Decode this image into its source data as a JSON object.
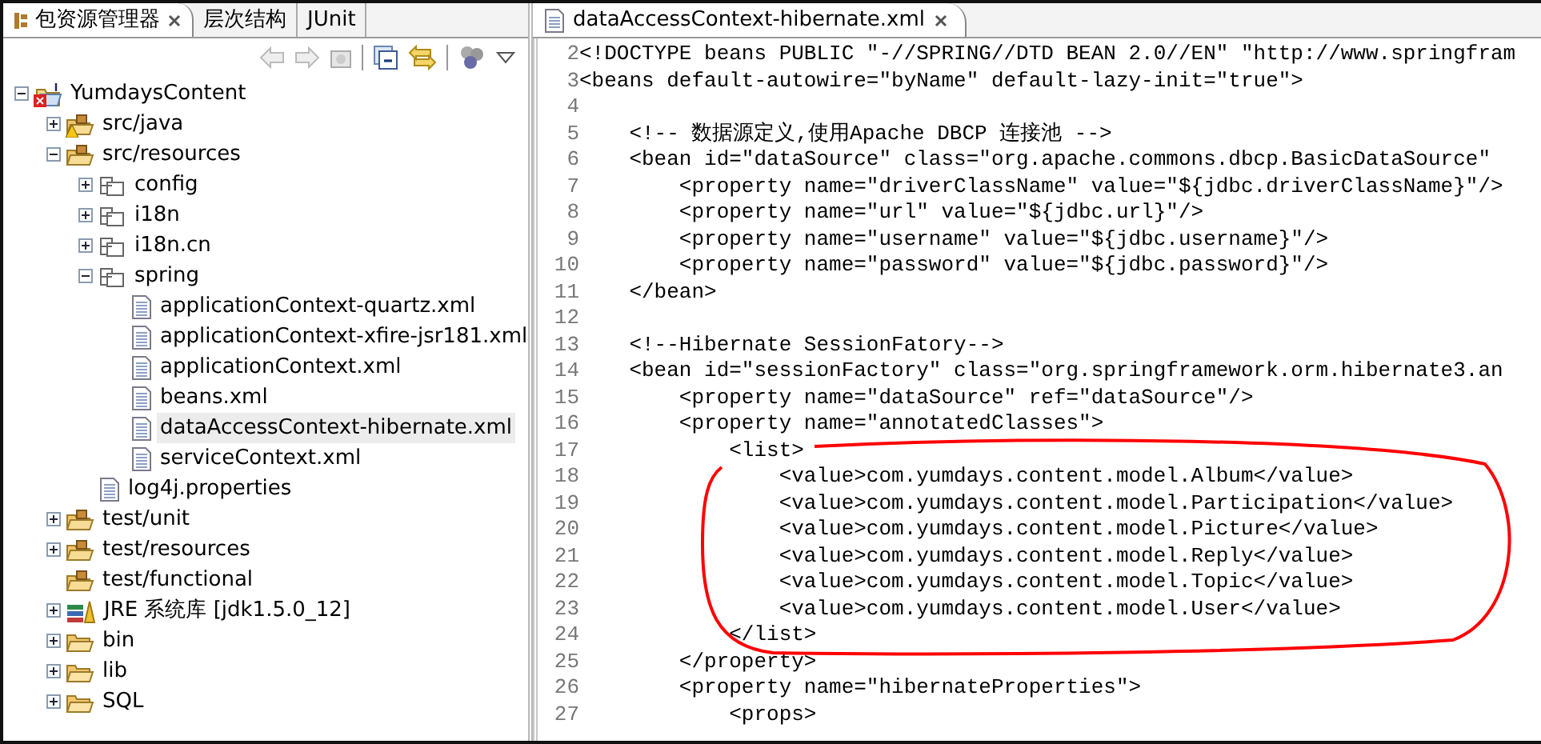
{
  "explorer": {
    "tabs": [
      {
        "label": "包资源管理器",
        "selected": true,
        "closable": true
      },
      {
        "label": "层次结构",
        "selected": false,
        "closable": false
      },
      {
        "label": "JUnit",
        "selected": false,
        "closable": false
      }
    ],
    "tree": [
      {
        "label": "YumdaysContent",
        "kind": "project",
        "error": true,
        "expanded": true,
        "selected": false,
        "children": [
          {
            "label": "src/java",
            "kind": "srcfolder",
            "warning": true,
            "expanded": false,
            "selected": false
          },
          {
            "label": "src/resources",
            "kind": "srcfolder",
            "expanded": true,
            "selected": false,
            "children": [
              {
                "label": "config",
                "kind": "package",
                "expanded": false,
                "selected": false
              },
              {
                "label": "i18n",
                "kind": "package",
                "expanded": false,
                "selected": false
              },
              {
                "label": "i18n.cn",
                "kind": "package",
                "expanded": false,
                "selected": false
              },
              {
                "label": "spring",
                "kind": "package",
                "expanded": true,
                "selected": false,
                "children": [
                  {
                    "label": "applicationContext-quartz.xml",
                    "kind": "file",
                    "selected": false
                  },
                  {
                    "label": "applicationContext-xfire-jsr181.xml",
                    "kind": "file",
                    "selected": false
                  },
                  {
                    "label": "applicationContext.xml",
                    "kind": "file",
                    "selected": false
                  },
                  {
                    "label": "beans.xml",
                    "kind": "file",
                    "selected": false
                  },
                  {
                    "label": "dataAccessContext-hibernate.xml",
                    "kind": "file",
                    "selected": true
                  },
                  {
                    "label": "serviceContext.xml",
                    "kind": "file",
                    "selected": false
                  }
                ]
              },
              {
                "label": "log4j.properties",
                "kind": "file",
                "selected": false
              }
            ]
          },
          {
            "label": "test/unit",
            "kind": "srcfolder",
            "expanded": false,
            "selected": false
          },
          {
            "label": "test/resources",
            "kind": "srcfolder",
            "expanded": false,
            "selected": false
          },
          {
            "label": "test/functional",
            "kind": "srcfolder",
            "selected": false
          },
          {
            "label": "JRE 系统库 [jdk1.5.0_12]",
            "kind": "library",
            "expanded": false,
            "selected": false
          },
          {
            "label": "bin",
            "kind": "folder",
            "expanded": false,
            "selected": false
          },
          {
            "label": "lib",
            "kind": "folder",
            "expanded": false,
            "selected": false
          },
          {
            "label": "SQL",
            "kind": "folder",
            "expanded": false,
            "selected": false
          }
        ]
      }
    ]
  },
  "editor": {
    "tab": {
      "label": "dataAccessContext-hibernate.xml",
      "selected": true
    },
    "lines": [
      {
        "number": "2",
        "text": "<!DOCTYPE beans PUBLIC \"-//SPRING//DTD BEAN 2.0//EN\" \"http://www.springfram"
      },
      {
        "number": "3",
        "text": "<beans default-autowire=\"byName\" default-lazy-init=\"true\">"
      },
      {
        "number": "4"
      },
      {
        "number": "5",
        "text": "    <!-- 数据源定义,使用Apache DBCP 连接池 -->"
      },
      {
        "number": "6",
        "text": "    <bean id=\"dataSource\" class=\"org.apache.commons.dbcp.BasicDataSource\""
      },
      {
        "number": "7",
        "text": "        <property name=\"driverClassName\" value=\"${jdbc.driverClassName}\"/>"
      },
      {
        "number": "8",
        "text": "        <property name=\"url\" value=\"${jdbc.url}\"/>"
      },
      {
        "number": "9",
        "text": "        <property name=\"username\" value=\"${jdbc.username}\"/>"
      },
      {
        "number": "10",
        "text": "        <property name=\"password\" value=\"${jdbc.password}\"/>"
      },
      {
        "number": "11",
        "text": "    </bean>"
      },
      {
        "number": "12"
      },
      {
        "number": "13",
        "text": "    <!--Hibernate SessionFatory-->"
      },
      {
        "number": "14",
        "text": "    <bean id=\"sessionFactory\" class=\"org.springframework.orm.hibernate3.an"
      },
      {
        "number": "15",
        "text": "        <property name=\"dataSource\" ref=\"dataSource\"/>"
      },
      {
        "number": "16",
        "text": "        <property name=\"annotatedClasses\">"
      },
      {
        "number": "17",
        "text": "            <list>"
      },
      {
        "number": "18",
        "text": "                <value>com.yumdays.content.model.Album</value>"
      },
      {
        "number": "19",
        "text": "                <value>com.yumdays.content.model.Participation</value>"
      },
      {
        "number": "20",
        "text": "                <value>com.yumdays.content.model.Picture</value>"
      },
      {
        "number": "21",
        "text": "                <value>com.yumdays.content.model.Reply</value>"
      },
      {
        "number": "22",
        "text": "                <value>com.yumdays.content.model.Topic</value>"
      },
      {
        "number": "23",
        "text": "                <value>com.yumdays.content.model.User</value>"
      },
      {
        "number": "24",
        "text": "            </list>"
      },
      {
        "number": "25",
        "text": "        </property>"
      },
      {
        "number": "26",
        "text": "        <property name=\"hibernateProperties\">"
      },
      {
        "number": "27",
        "text": "            <props>"
      }
    ]
  }
}
